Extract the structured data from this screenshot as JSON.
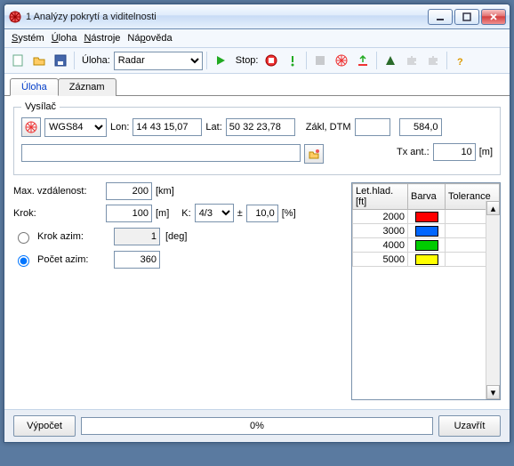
{
  "window": {
    "title": "1 Analýzy pokrytí a viditelnosti"
  },
  "menu": {
    "system": "Systém",
    "uloha": "Úloha",
    "nastroje": "Nástroje",
    "napoveda": "Nápověda"
  },
  "toolbar": {
    "uloha_label": "Úloha:",
    "uloha_value": "Radar",
    "stop_label": "Stop:"
  },
  "tabs": {
    "uloha": "Úloha",
    "zaznam": "Záznam"
  },
  "tx": {
    "legend": "Vysílač",
    "crs": "WGS84",
    "lon_label": "Lon:",
    "lon": "14 43 15,07",
    "lat_label": "Lat:",
    "lat": "50 32 23,78",
    "zakl_label": "Zákl, DTM",
    "zakl": "",
    "elev": "584,0",
    "path": "",
    "txant_label": "Tx ant.:",
    "txant": "10",
    "txant_unit": "[m]"
  },
  "params": {
    "maxdist_label": "Max. vzdálenost:",
    "maxdist": "200",
    "maxdist_unit": "[km]",
    "krok_label": "Krok:",
    "krok": "100",
    "krok_unit": "[m]",
    "k_label": "K:",
    "k": "4/3",
    "plusminus": "±",
    "tol": "10,0",
    "tol_unit": "[%]",
    "krok_azim_label": "Krok azim:",
    "krok_azim": "1",
    "deg_unit": "[deg]",
    "pocet_azim_label": "Počet azim:",
    "pocet_azim": "360"
  },
  "levels": {
    "headers": {
      "alt": "Let.hlad. [ft]",
      "color": "Barva",
      "tol": "Tolerance"
    },
    "rows": [
      {
        "alt": "2000",
        "color": "#ff0000"
      },
      {
        "alt": "3000",
        "color": "#0066ff"
      },
      {
        "alt": "4000",
        "color": "#00cc00"
      },
      {
        "alt": "5000",
        "color": "#ffff00"
      }
    ]
  },
  "bottom": {
    "compute": "Výpočet",
    "progress": "0%",
    "close": "Uzavřít"
  }
}
